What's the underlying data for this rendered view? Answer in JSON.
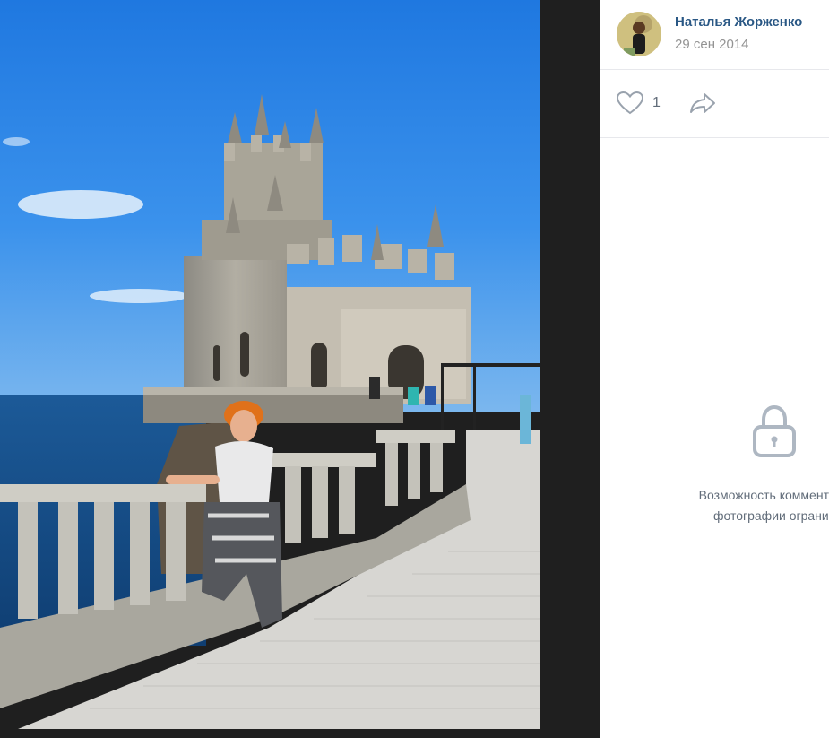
{
  "photo": {
    "description_icon": "photo-castle-seaside"
  },
  "author": {
    "name": "Наталья Жорженко",
    "date": "29 сен 2014",
    "avatar_icon": "user-avatar"
  },
  "actions": {
    "likes": "1",
    "like_icon": "heart-icon",
    "share_icon": "share-arrow-icon"
  },
  "comments": {
    "lock_icon": "lock-icon",
    "line1": "Возможность комментиро",
    "line2": "фотографии огранич"
  },
  "colors": {
    "accent": "#2a5885",
    "muted": "#939393",
    "icon": "#99a2ad",
    "viewer_bg": "#1f1f1f"
  }
}
